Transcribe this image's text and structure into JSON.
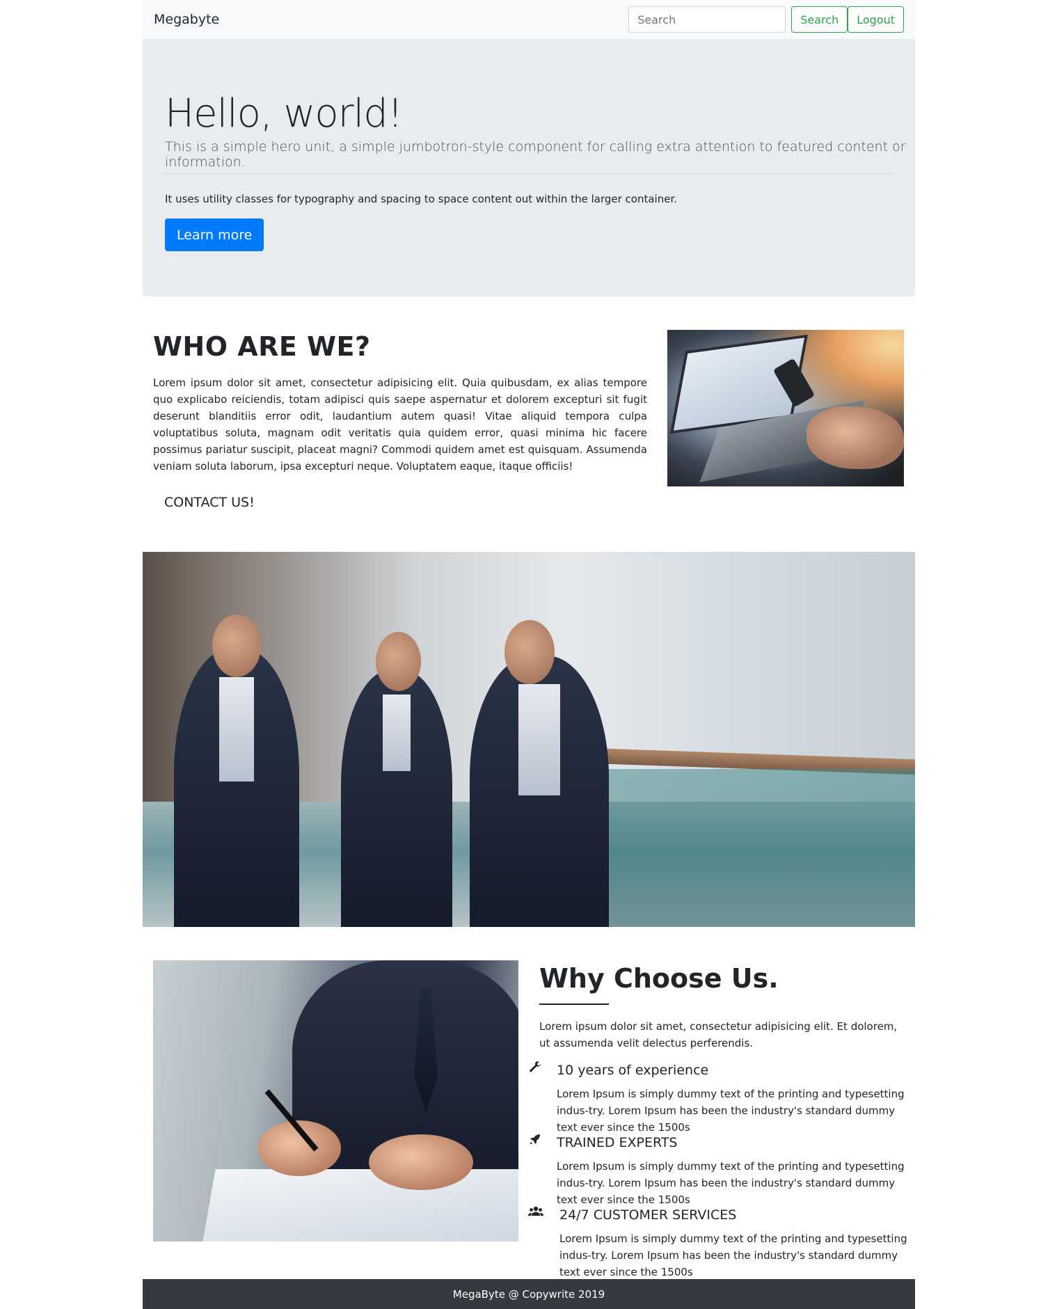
{
  "navbar": {
    "brand": "Megabyte",
    "search_placeholder": "Search",
    "search_button": "Search",
    "logout_button": "Logout"
  },
  "jumbotron": {
    "heading": "Hello, world!",
    "lead": "This is a simple hero unit, a simple jumbotron-style component for calling extra attention to featured content or information.",
    "text": "It uses utility classes for typography and spacing to space content out within the larger container.",
    "button": "Learn more"
  },
  "about": {
    "title": "WHO ARE WE?",
    "text": "Lorem ipsum dolor sit amet, consectetur adipisicing elit. Quia quibusdam, ex alias tempore quo explicabo reiciendis, totam adipisci quis saepe aspernatur et dolorem excepturi sit fugit deserunt blanditiis error odit, laudantium autem quasi! Vitae aliquid tempora culpa voluptatibus soluta, magnam odit veritatis quia quidem error, quasi minima hic facere possimus pariatur suscipit, placeat magni? Commodi quidem amet est quisquam. Assumenda veniam soluta laborum, ipsa excepturi neque. Voluptatem eaque, itaque officiis!",
    "contact": "CONTACT US!"
  },
  "why": {
    "title": "Why Choose Us.",
    "intro": "Lorem ipsum dolor sit amet, consectetur adipisicing elit. Et dolorem, ut assumenda velit delectus perferendis.",
    "features": [
      {
        "icon": "wrench-icon",
        "title": "10 years of experience",
        "text": "Lorem Ipsum is simply dummy text of the printing and typesetting indus-try. Lorem Ipsum has been the industry's standard dummy text ever since the 1500s"
      },
      {
        "icon": "rocket-icon",
        "title": "TRAINED EXPERTS",
        "text": "Lorem Ipsum is simply dummy text of the printing and typesetting indus-try. Lorem Ipsum has been the industry's standard dummy text ever since the 1500s"
      },
      {
        "icon": "users-icon",
        "title": "24/7 CUSTOMER SERVICES",
        "text": "Lorem Ipsum is simply dummy text of the printing and typesetting indus-try. Lorem Ipsum has been the industry's standard dummy text ever since the 1500s"
      }
    ]
  },
  "footer": {
    "text": "MegaByte @ Copywrite 2019"
  },
  "colors": {
    "primary": "#007bff",
    "success": "#28a745",
    "jumbotron_bg": "#e9ecef",
    "navbar_bg": "#f8f9fa",
    "footer_bg": "#343a40"
  }
}
